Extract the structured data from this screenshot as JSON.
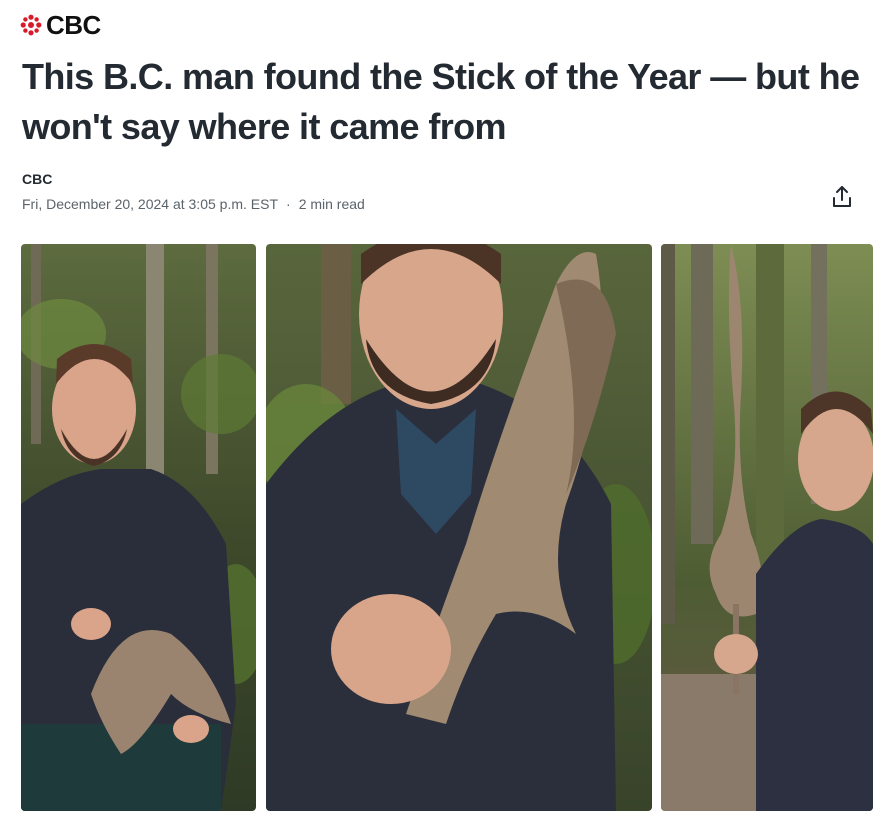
{
  "brand": {
    "logo_text": "CBC",
    "logo_color": "#d91a2a",
    "logo_icon": "cbc-gem-icon"
  },
  "article": {
    "headline": "This B.C. man found the Stick of the Year — but he won't say where it came from",
    "author": "CBC",
    "date": "Fri, December 20, 2024 at 3:05 p.m. EST",
    "separator": "·",
    "read_time": "2 min read"
  },
  "actions": {
    "share_icon": "share-icon"
  },
  "gallery": {
    "photos": [
      {
        "id": "photo-1",
        "subject": "man holding driftwood stick in forest"
      },
      {
        "id": "photo-2",
        "subject": "man holding driftwood stick close-up"
      },
      {
        "id": "photo-3",
        "subject": "man holding tall twisted driftwood stick on trail"
      }
    ]
  }
}
